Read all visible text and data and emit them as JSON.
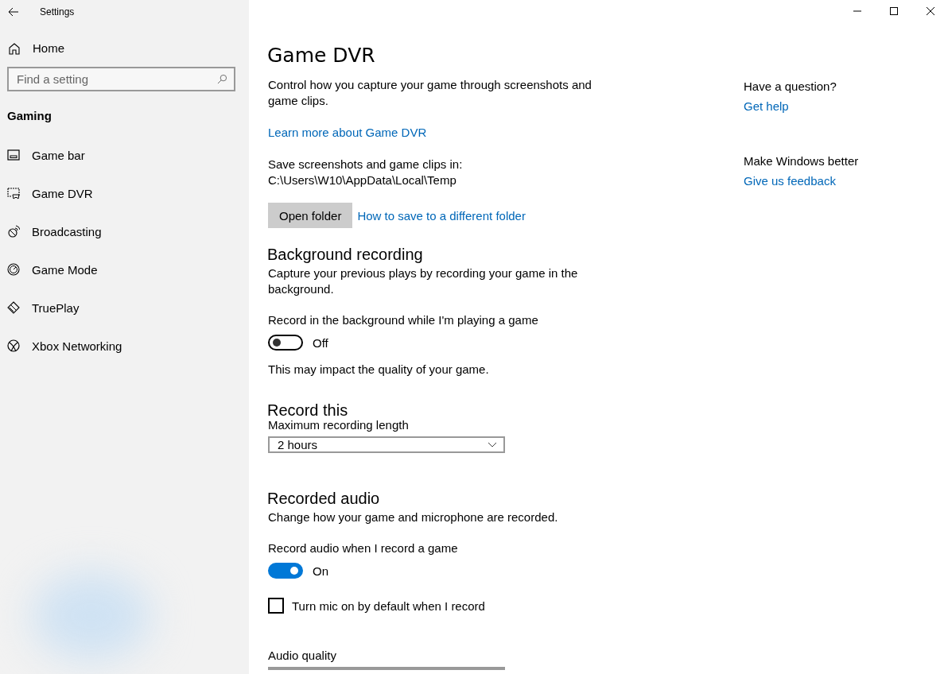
{
  "window": {
    "title": "Settings"
  },
  "sidebar": {
    "home": "Home",
    "search": {
      "placeholder": "Find a setting"
    },
    "section": "Gaming",
    "items": [
      {
        "label": "Game bar"
      },
      {
        "label": "Game DVR"
      },
      {
        "label": "Broadcasting"
      },
      {
        "label": "Game Mode"
      },
      {
        "label": "TruePlay"
      },
      {
        "label": "Xbox Networking"
      }
    ]
  },
  "page": {
    "title": "Game DVR",
    "blocks": [
      {
        "kind": "text",
        "text": "Control how you capture your game through screenshots and game clips."
      },
      {
        "kind": "link",
        "text": "Learn more about Game DVR"
      },
      {
        "kind": "text",
        "text": "Save screenshots and game clips in: C:\\Users\\W10\\AppData\\Local\\Temp"
      },
      {
        "kind": "buttonrow",
        "button": "Open folder",
        "link": "How to save to a different folder"
      },
      {
        "kind": "heading",
        "text": "Background recording"
      },
      {
        "kind": "text",
        "text": "Capture your previous plays by recording your game in the background."
      },
      {
        "kind": "toggle",
        "label": "Record in the background while I'm playing a game",
        "on": false,
        "state": "Off"
      },
      {
        "kind": "text",
        "text": "This may impact the quality of your game."
      },
      {
        "kind": "heading",
        "text": "Record this"
      },
      {
        "kind": "dropdown",
        "label": "Maximum recording length",
        "value": "2 hours"
      },
      {
        "kind": "heading",
        "text": "Recorded audio"
      },
      {
        "kind": "text",
        "text": "Change how your game and microphone are recorded."
      },
      {
        "kind": "toggle",
        "label": "Record audio when I record a game",
        "on": true,
        "state": "On"
      },
      {
        "kind": "checkbox",
        "label": "Turn mic on by default when I record",
        "checked": false
      },
      {
        "kind": "dropdown",
        "label": "Audio quality"
      }
    ]
  },
  "aside": [
    {
      "heading": "Have a question?",
      "link": "Get help"
    },
    {
      "heading": "Make Windows better",
      "link": "Give us feedback"
    }
  ]
}
